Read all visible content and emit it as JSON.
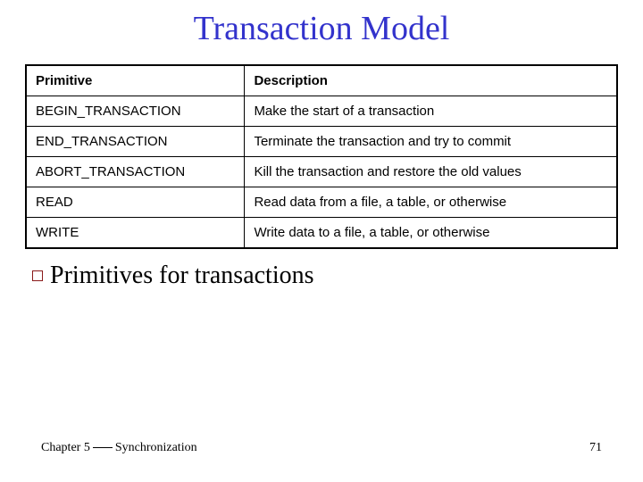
{
  "title": "Transaction Model",
  "table": {
    "headers": {
      "primitive": "Primitive",
      "description": "Description"
    },
    "rows": [
      {
        "primitive": "BEGIN_TRANSACTION",
        "description": "Make the start of a transaction"
      },
      {
        "primitive": "END_TRANSACTION",
        "description": "Terminate the transaction and try to commit"
      },
      {
        "primitive": "ABORT_TRANSACTION",
        "description": "Kill the transaction and restore the old values"
      },
      {
        "primitive": "READ",
        "description": "Read data from a file, a table, or otherwise"
      },
      {
        "primitive": "WRITE",
        "description": "Write data to a file, a table, or otherwise"
      }
    ]
  },
  "caption": "Primitives for transactions",
  "footer": {
    "chapter_prefix": "Chapter 5",
    "chapter_suffix": "Synchronization",
    "page": "71"
  }
}
